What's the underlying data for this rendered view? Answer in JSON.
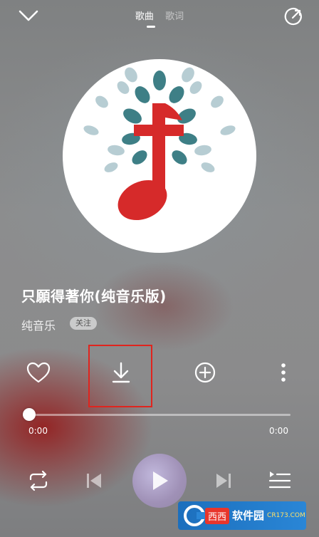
{
  "header": {
    "tabs": [
      {
        "label": "歌曲",
        "active": true
      },
      {
        "label": "歌词",
        "active": false
      }
    ],
    "collapse_icon": "chevron-down-icon",
    "share_icon": "share-icon"
  },
  "song": {
    "title": "只願得著你(纯音乐版)",
    "artist": "纯音乐",
    "follow_label": "关注"
  },
  "actions": {
    "like_icon": "heart-icon",
    "download_icon": "download-icon",
    "add_icon": "plus-circle-icon",
    "more_icon": "more-vertical-icon",
    "highlight_color": "#e0241e"
  },
  "progress": {
    "current": "0:00",
    "total": "0:00",
    "fraction": 0
  },
  "controls": {
    "repeat_icon": "repeat-icon",
    "prev_icon": "skip-previous-icon",
    "play_icon": "play-icon",
    "next_icon": "skip-next-icon",
    "playlist_icon": "playlist-icon"
  },
  "watermark": {
    "brand": "西西",
    "text": "软件园",
    "sub": "CR173.COM"
  },
  "colors": {
    "logo_red": "#d62a2a",
    "leaf_teal": "#3e7f86",
    "leaf_light": "#b7cdd3"
  }
}
